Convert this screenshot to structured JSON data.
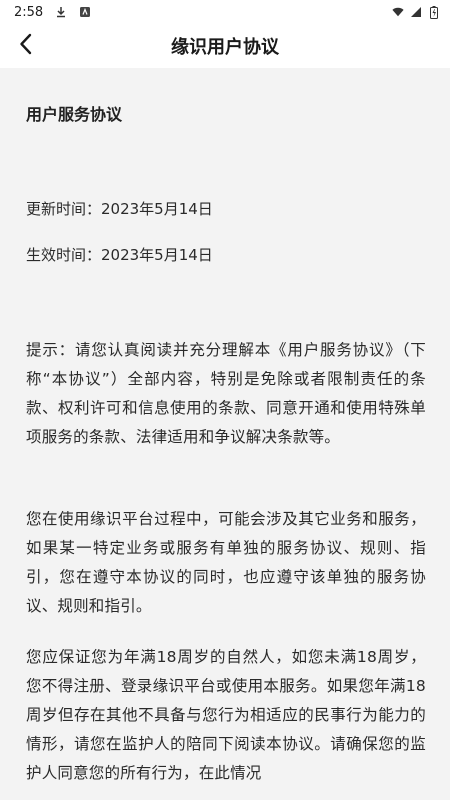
{
  "status_bar": {
    "time": "2:58",
    "icons": [
      "download-icon",
      "app-notification-icon",
      "wifi-icon",
      "signal-icon",
      "battery-icon"
    ]
  },
  "header": {
    "back_icon": "chevron-left-icon",
    "title": "缘识用户协议"
  },
  "document": {
    "heading": "用户服务协议",
    "updated": "更新时间：2023年5月14日",
    "effective": "生效时间：2023年5月14日",
    "paragraphs": [
      "提示：请您认真阅读并充分理解本《用户服务协议》（下称“本协议”）全部内容，特别是免除或者限制责任的条款、权利许可和信息使用的条款、同意开通和使用特殊单项服务的条款、法律适用和争议解决条款等。",
      "您在使用缘识平台过程中，可能会涉及其它业务和服务，如果某一特定业务或服务有单独的服务协议、规则、指引，您在遵守本协议的同时，也应遵守该单独的服务协议、规则和指引。",
      "您应保证您为年满18周岁的自然人，如您未满18周岁，您不得注册、登录缘识平台或使用本服务。如果您年满18周岁但存在其他不具备与您行为相适应的民事行为能力的情形，请您在监护人的陪同下阅读本协议。请确保您的监护人同意您的所有行为，在此情况"
    ]
  },
  "colors": {
    "background": "#f3f3f3",
    "header_bg": "#ffffff",
    "text": "#2a2a2a"
  }
}
